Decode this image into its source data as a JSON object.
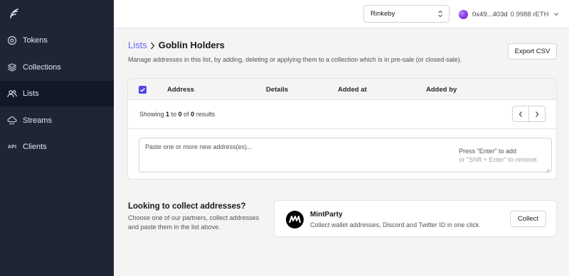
{
  "sidebar": {
    "logo_icon": "feather-logo-icon",
    "items": [
      {
        "label": "Tokens",
        "icon": "target-icon",
        "active": false
      },
      {
        "label": "Collections",
        "icon": "layers-icon",
        "active": false
      },
      {
        "label": "Lists",
        "icon": "users-icon",
        "active": true
      },
      {
        "label": "Streams",
        "icon": "cloud-rain-icon",
        "active": false
      },
      {
        "label": "Clients",
        "icon": "API",
        "active": false
      }
    ]
  },
  "header": {
    "network": "Rinkeby",
    "wallet_address": "0x49...403d",
    "wallet_balance": "0.9988 rETH"
  },
  "page": {
    "breadcrumb_parent": "Lists",
    "breadcrumb_current": "Goblin Holders",
    "subtitle": "Manage addresses in this list, by adding, deleting or applying them to a collection which is in pre-sale (or closed-sale).",
    "export_label": "Export CSV"
  },
  "table": {
    "columns": [
      "Address",
      "Details",
      "Added at",
      "Added by"
    ],
    "showing_prefix": "Showing",
    "showing_from": "1",
    "showing_to_word": "to",
    "showing_to": "0",
    "showing_of_word": "of",
    "showing_total": "0",
    "showing_suffix": "results"
  },
  "address_input": {
    "placeholder": "Paste one or more new address(es)...",
    "hint_enter": "Press \"Enter\" to add",
    "hint_remove": "or \"Shift + Enter\" to remove."
  },
  "collect": {
    "title": "Looking to collect addresses?",
    "description": "Choose one of our partners, collect addresses and paste them in the list above.",
    "partner_name": "MintParty",
    "partner_description": "Collect wallet addresses, Discord and Twitter ID in one click",
    "button_label": "Collect"
  },
  "colors": {
    "sidebar_bg": "#1e2535",
    "sidebar_active": "#111827",
    "accent": "#6366f1"
  }
}
